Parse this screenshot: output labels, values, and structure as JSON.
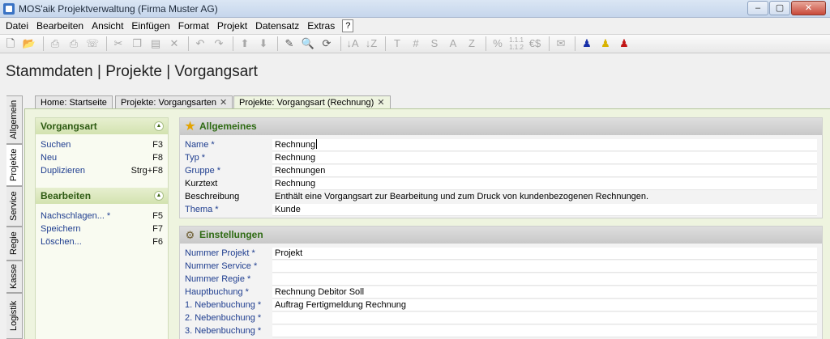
{
  "window": {
    "title": "MOS'aik Projektverwaltung (Firma Muster AG)",
    "controls": {
      "minimize": "–",
      "maximize": "▢",
      "close": "✕"
    }
  },
  "menu": {
    "items": [
      "Datei",
      "Bearbeiten",
      "Ansicht",
      "Einfügen",
      "Format",
      "Projekt",
      "Datensatz",
      "Extras"
    ],
    "help": "?"
  },
  "toolbar": {
    "text_buttons": [
      "T",
      "#",
      "S",
      "A",
      "Z",
      "%",
      "1.1.1 1.1.2",
      "€$"
    ],
    "icons": [
      "new-document",
      "open-folder",
      "print-preview",
      "print",
      "fax",
      "cut",
      "copy",
      "paste",
      "delete",
      "undo",
      "redo",
      "move-up",
      "move-down",
      "edit",
      "search",
      "refresh",
      "sort-ascending",
      "sort-descending",
      "email",
      "user-blue",
      "user-yellow",
      "user-red"
    ]
  },
  "page": {
    "title": "Stammdaten | Projekte | Vorgangsart"
  },
  "side_tabs": [
    "Allgemein",
    "Projekte",
    "Service",
    "Regie",
    "Kasse",
    "Logistik"
  ],
  "doc_tabs": [
    {
      "label": "Home: Startseite"
    },
    {
      "label": "Projekte: Vorgangsarten"
    },
    {
      "label": "Projekte: Vorgangsart (Rechnung)"
    }
  ],
  "tasks": {
    "vorgangsart": {
      "title": "Vorgangsart",
      "links": [
        {
          "label": "Suchen",
          "key": "F3"
        },
        {
          "label": "Neu",
          "key": "F8"
        },
        {
          "label": "Duplizieren",
          "key": "Strg+F8"
        }
      ]
    },
    "bearbeiten": {
      "title": "Bearbeiten",
      "links": [
        {
          "label": "Nachschlagen... *",
          "key": "F5"
        },
        {
          "label": "Speichern",
          "key": "F7"
        },
        {
          "label": "Löschen...",
          "key": "F6"
        }
      ]
    }
  },
  "allgemeines": {
    "title": "Allgemeines",
    "rows": [
      {
        "label": "Name *",
        "value": "Rechnung"
      },
      {
        "label": "Typ *",
        "value": "Rechnung"
      },
      {
        "label": "Gruppe *",
        "value": "Rechnungen"
      },
      {
        "label": "Kurztext",
        "value": "Rechnung"
      },
      {
        "label": "Beschreibung",
        "value": "Enthält eine Vorgangsart zur Bearbeitung und zum Druck von kundenbezogenen Rechnungen."
      },
      {
        "label": "Thema *",
        "value": "Kunde"
      }
    ]
  },
  "einstellungen": {
    "title": "Einstellungen",
    "rows": [
      {
        "label": "Nummer Projekt *",
        "value": "Projekt"
      },
      {
        "label": "Nummer Service *",
        "value": ""
      },
      {
        "label": "Nummer Regie *",
        "value": ""
      },
      {
        "label": "Hauptbuchung *",
        "value": "Rechnung Debitor Soll"
      },
      {
        "label": "1. Nebenbuchung *",
        "value": "Auftrag Fertigmeldung Rechnung"
      },
      {
        "label": "2. Nebenbuchung *",
        "value": ""
      },
      {
        "label": "3. Nebenbuchung *",
        "value": ""
      }
    ]
  }
}
